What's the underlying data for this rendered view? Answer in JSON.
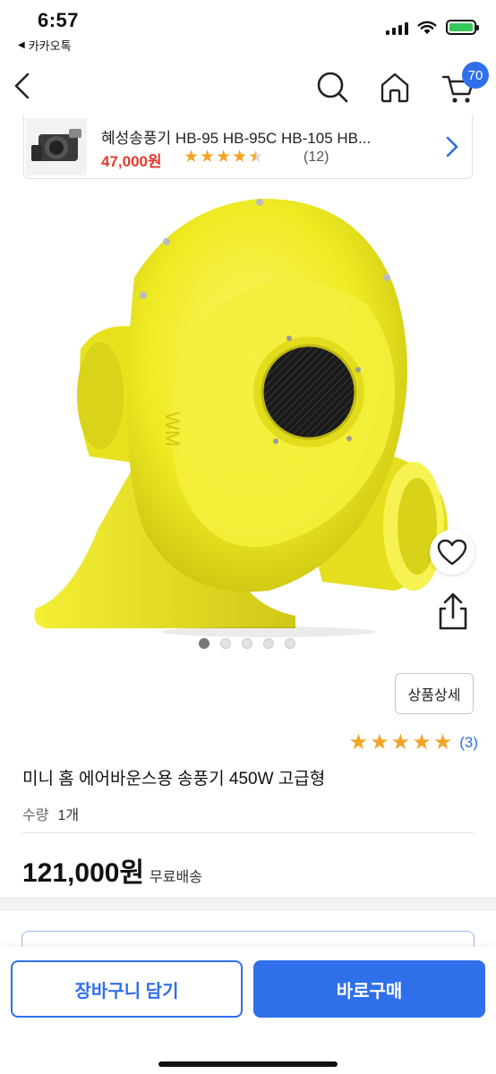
{
  "status_bar": {
    "time": "6:57",
    "back_app": "카카오톡"
  },
  "nav": {
    "cart_count": "70"
  },
  "related_product": {
    "title": "혜성송풍기 HB-95 HB-95C HB-105 HB...",
    "price": "47,000원",
    "rating": 4.5,
    "review_count": "(12)"
  },
  "gallery": {
    "image_count": 5,
    "active_index": 0
  },
  "product": {
    "detail_button": "상품상세",
    "rating": 5,
    "review_count": "(3)",
    "name": "미니 홈 에어바운스용 송풍기 450W 고급형",
    "qty_label": "수량",
    "qty_value": "1개",
    "price": "121,000원",
    "shipping": "무료배송"
  },
  "bottom_bar": {
    "cart_button": "장바구니 담기",
    "buy_button": "바로구매"
  },
  "colors": {
    "accent": "#2f6fea",
    "price_red": "#e23a2e",
    "star": "#f2a427",
    "product_yellow": "#f2ee2a"
  }
}
